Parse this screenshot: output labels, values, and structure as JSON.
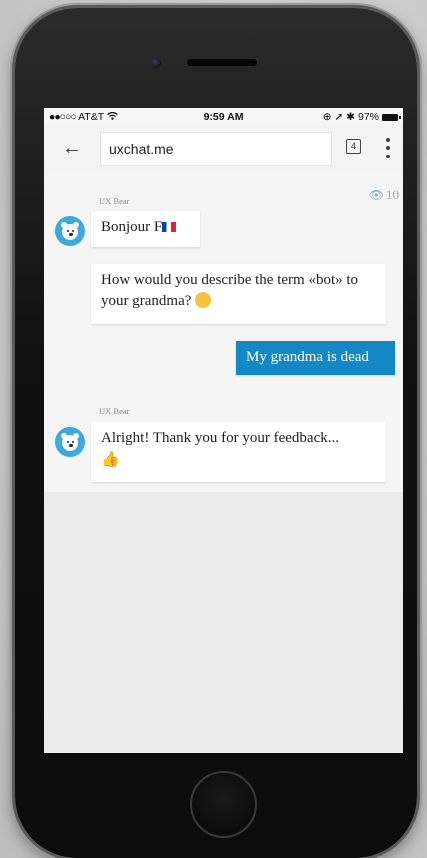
{
  "status_bar": {
    "signal": "●●○○○",
    "carrier": "AT&T",
    "wifi_icon": "wifi-icon",
    "time": "9:59 AM",
    "indicators": "⊕ ➚ ✱",
    "battery": "97%"
  },
  "toolbar": {
    "back_icon": "←",
    "url": "uxchat.me",
    "tab_count": "4",
    "menu_icon": "more-vertical-icon"
  },
  "chat": {
    "visits": "10",
    "messages": [
      {
        "sender": "UX Bear",
        "text": "Bonjour F",
        "emoji": "flag-france"
      },
      {
        "text": "How would you describe the term «bot» to your grandma?",
        "emoji": "thinking-face"
      },
      {
        "from_user": true,
        "text": "My grandma is dead"
      },
      {
        "sender": "UX Bear",
        "text": "Alright! Thank you for your feedback...",
        "emoji": "thumbs-up"
      }
    ]
  },
  "colors": {
    "user_bubble": "#1488c6",
    "avatar": "#3fa9dd"
  }
}
